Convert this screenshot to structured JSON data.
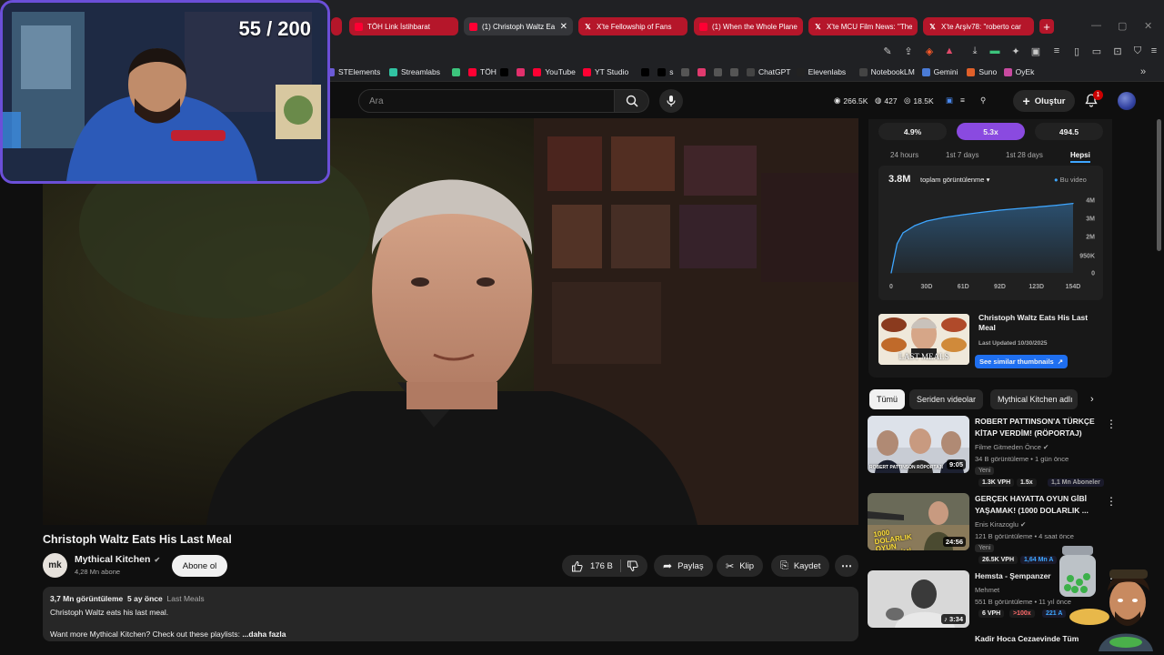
{
  "browser": {
    "tabs": [
      {
        "label": "TÖH Link İstihbarat",
        "favicon": "youtube",
        "active": false
      },
      {
        "label": "(1) Christoph Waltz Ea",
        "favicon": "youtube",
        "active": true
      },
      {
        "label": "X'te Fellowship of Fans",
        "favicon": "x",
        "active": false
      },
      {
        "label": "(1) When the Whole Plane",
        "favicon": "youtube",
        "active": false
      },
      {
        "label": "X'te MCU Film News: \"The",
        "favicon": "x",
        "active": false
      },
      {
        "label": "X'te Arşiv78: \"roberto car",
        "favicon": "x",
        "active": false
      }
    ],
    "new_tab": "+",
    "bookmarks": [
      {
        "label": "STElements",
        "color": "#6b5bd6"
      },
      {
        "label": "Streamlabs",
        "color": "#31c3a2"
      },
      {
        "label": "",
        "color": "#3cc47c"
      },
      {
        "label": "TÖH",
        "color": "#ff0033"
      },
      {
        "label": "",
        "color": "#000000"
      },
      {
        "label": "",
        "color": "#e1306c"
      },
      {
        "label": "YouTube",
        "color": "#ff0033"
      },
      {
        "label": "YT Studio",
        "color": "#ff0033"
      },
      {
        "label": "",
        "color": "#000000"
      },
      {
        "label": "s",
        "color": "#000000"
      },
      {
        "label": "",
        "color": "#555555"
      },
      {
        "label": "",
        "color": "#e03a6e"
      },
      {
        "label": "",
        "color": "#555555"
      },
      {
        "label": "",
        "color": "#555555"
      },
      {
        "label": "ChatGPT",
        "color": "#444444"
      },
      {
        "label": "Elevenlabs",
        "color": "#222222"
      },
      {
        "label": "NotebookLM",
        "color": "#444444"
      },
      {
        "label": "Gemini",
        "color": "#4a7bd6"
      },
      {
        "label": "Suno",
        "color": "#e0602a"
      },
      {
        "label": "OyEk",
        "color": "#c84aa0"
      }
    ]
  },
  "youtube": {
    "search_placeholder": "Ara",
    "stats": {
      "views": "266.5K",
      "likes": "427",
      "subs": "18.5K"
    },
    "create_label": "Oluştur",
    "notif_count": "1"
  },
  "overlay": {
    "counter": "55 / 200"
  },
  "video": {
    "title": "Christoph Waltz Eats His Last Meal",
    "channel": "Mythical Kitchen",
    "channel_initials": "mk",
    "subscribers": "4,28 Mn abone",
    "subscribe_label": "Abone ol",
    "likes": "176 B",
    "share_label": "Paylaş",
    "clip_label": "Klip",
    "save_label": "Kaydet",
    "desc_views": "3,7 Mn görüntüleme",
    "desc_age": "5 ay önce",
    "desc_tag": "Last Meals",
    "desc_line1": "Christoph Waltz eats his last meal.",
    "desc_line2": "Want more Mythical Kitchen? Check out these playlists:",
    "more_label": "...daha fazla"
  },
  "analytics": {
    "segments": [
      "4.9%",
      "5.3x",
      "494.5"
    ],
    "selected_segment": 1,
    "ranges": [
      "24 hours",
      "1st 7 days",
      "1st 28 days",
      "Hepsi"
    ],
    "selected_range": 3,
    "total": "3.8M",
    "metric": "toplam görüntülenme",
    "legend": "Bu video"
  },
  "chart_data": {
    "type": "line",
    "title": "",
    "x": [
      0,
      5,
      10,
      20,
      30,
      45,
      61,
      75,
      92,
      110,
      123,
      140,
      154
    ],
    "series": [
      {
        "name": "Bu video",
        "values": [
          0,
          1.6,
          2.2,
          2.6,
          2.85,
          3.05,
          3.2,
          3.32,
          3.45,
          3.55,
          3.62,
          3.72,
          3.82
        ]
      }
    ],
    "y_unit": "M",
    "xticks": [
      "0",
      "30D",
      "61D",
      "92D",
      "123D",
      "154D"
    ],
    "yticks": [
      "0",
      "950K",
      "2M",
      "3M",
      "4M"
    ],
    "ylim": [
      0,
      4
    ]
  },
  "thumb_card": {
    "title": "Christoph Waltz Eats His Last Meal",
    "updated": "Last Updated 10/30/2025",
    "button": "See similar thumbnails",
    "thumb_text": "LAST MEALS"
  },
  "chips": [
    "Tümü",
    "Seriden videolar",
    "Mythical Kitchen adlı"
  ],
  "recs": [
    {
      "title": "ROBERT PATTINSON'A TÜRKÇE KİTAP VERDİM! (RÖPORTAJ)",
      "channel": "Filme Gitmeden Önce",
      "meta": "34 B görüntüleme • 1 gün önce",
      "badge": "Yeni",
      "duration": "9:05",
      "thumb_text": "ROBERT PATTINSON RÖPORTAJI",
      "vph": "1.3K VPH",
      "ratio": "1.5x",
      "extra": "1,1 Mn Aboneler"
    },
    {
      "title": "GERÇEK HAYATTA OYUN GİBİ YAŞAMAK! (1000 DOLARLIK ...",
      "channel": "Enis Kirazoglu",
      "meta": "121 B görüntüleme • 4 saat önce",
      "badge": "Yeni",
      "duration": "24:56",
      "thumb_text": "1000 DOLARLIK OYUN DENEYİMİ",
      "vph": "26.5K VPH",
      "ratio": "",
      "extra": "1,64 Mn A"
    },
    {
      "title": "Hemsta - Şempanzer",
      "channel": "Mehmet",
      "meta": "551 B görüntüleme • 11 yıl önce",
      "badge": "",
      "duration": "3:34",
      "thumb_text": "",
      "vph": "6 VPH",
      "ratio": ">100x",
      "extra": "221 A"
    },
    {
      "title": "Kadir Hoca Cezaevinde Tüm",
      "channel": "",
      "meta": "",
      "badge": "",
      "duration": "",
      "thumb_text": "",
      "vph": "",
      "ratio": "",
      "extra": ""
    }
  ]
}
